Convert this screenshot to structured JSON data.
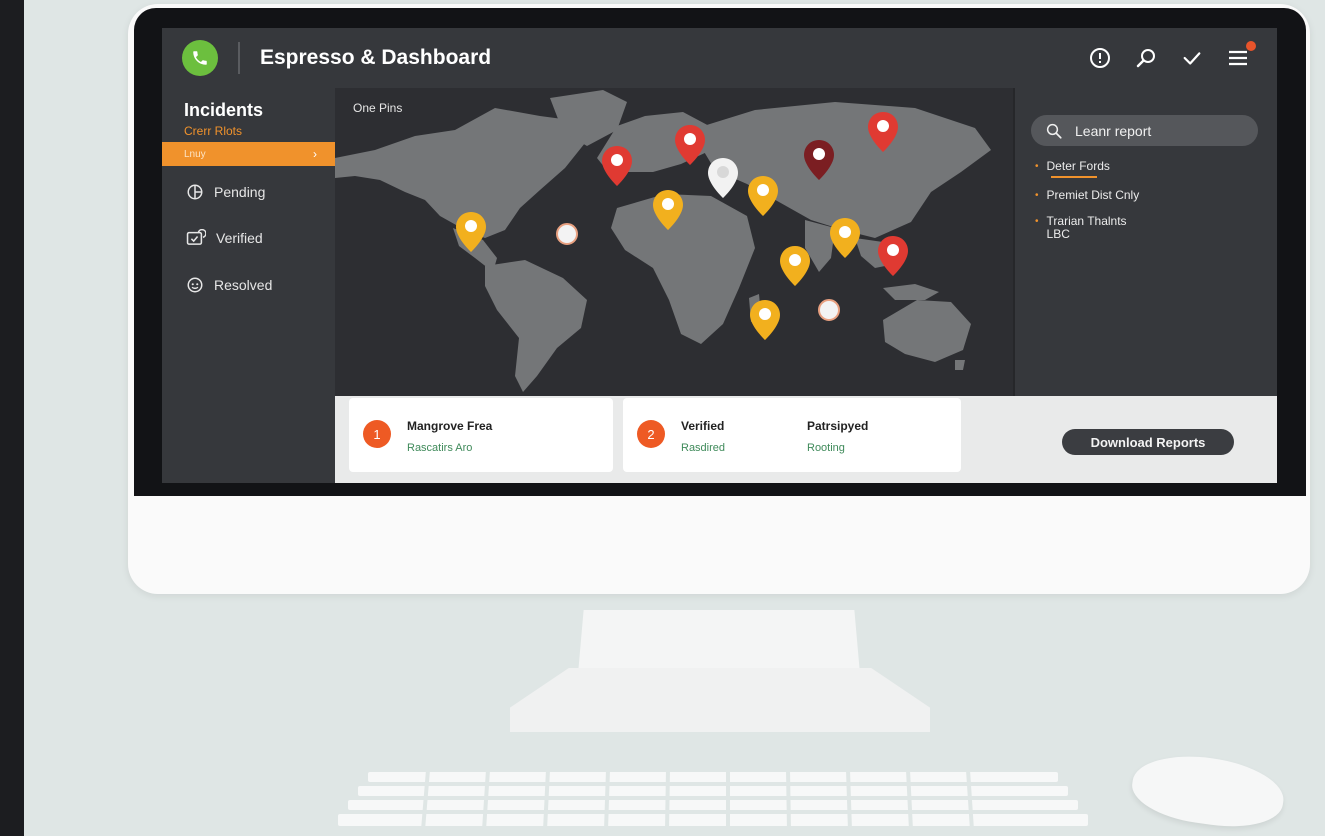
{
  "header": {
    "app_title": "Espresso & Dashboard",
    "icons": [
      "alert-circle-icon",
      "search-icon",
      "check-icon",
      "menu-icon"
    ]
  },
  "sidebar": {
    "title": "Incidents",
    "subtitle": "Crerr Rlots",
    "active_item": "Lnuy",
    "items": [
      {
        "label": "Pending",
        "icon": "pending-icon"
      },
      {
        "label": "Verified",
        "icon": "verified-icon"
      },
      {
        "label": "Resolved",
        "icon": "resolved-icon"
      }
    ]
  },
  "map": {
    "label": "One Pins",
    "pin_colors": {
      "red": "#e03a32",
      "yellow": "#f2b01e",
      "dark-red": "#7b1e22",
      "white": "#f2f2f2"
    }
  },
  "right_panel": {
    "search_label": "Leanr report",
    "items": [
      "Deter Fords",
      "Premiet Dist Cnly",
      "Trarian Thalnts",
      "LBC"
    ]
  },
  "bottom": {
    "card1": {
      "number": "1",
      "title": "Mangrove Frea",
      "subtitle": "Rascatirs Aro"
    },
    "card2": {
      "number": "2",
      "title": "Verified",
      "subtitle": "Rasdired",
      "title2": "Patrsipyed",
      "subtitle2": "Rooting"
    },
    "download_label": "Download Reports"
  },
  "colors": {
    "accent": "#f0922c",
    "badge": "#ee5a24",
    "logo": "#6cbf3e",
    "panel": "#36383c"
  }
}
